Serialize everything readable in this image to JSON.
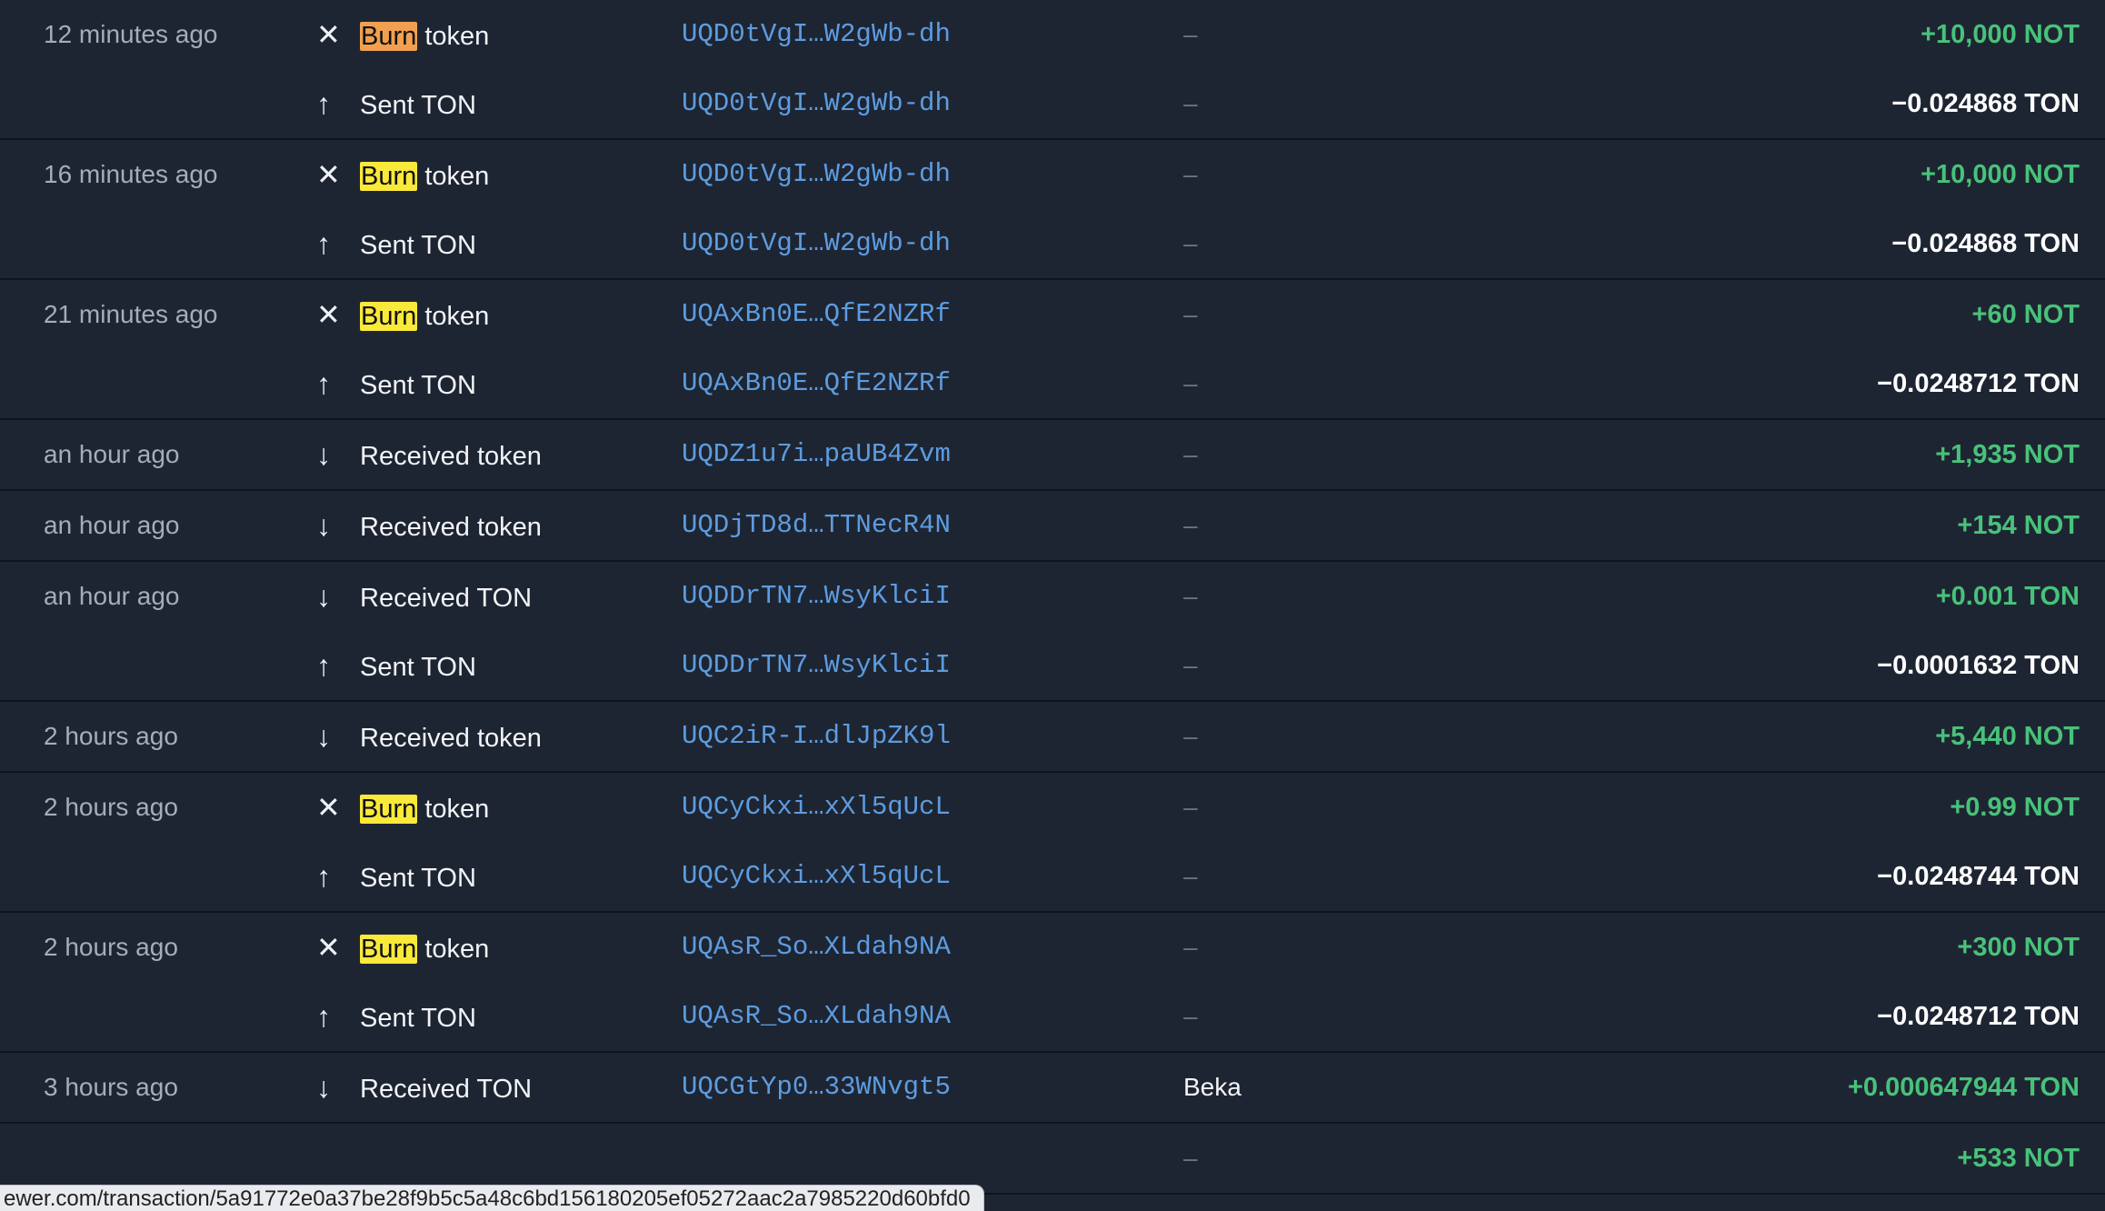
{
  "groups": [
    {
      "time": "12 minutes ago",
      "rows": [
        {
          "icon": "burn-icon",
          "glyph": "✕",
          "mark": "Burn",
          "mark_color": "#f0a050",
          "label": " token",
          "addr": "UQD0tVgI…W2gWb-dh",
          "memo": "–",
          "amount": "+10,000 NOT",
          "sign": "pos"
        },
        {
          "icon": "sent-arrow-icon",
          "glyph": "↑",
          "label": "Sent TON",
          "addr": "UQD0tVgI…W2gWb-dh",
          "memo": "–",
          "amount": "−0.024868 TON",
          "sign": "neg"
        }
      ]
    },
    {
      "time": "16 minutes ago",
      "rows": [
        {
          "icon": "burn-icon",
          "glyph": "✕",
          "mark": "Burn",
          "mark_color": "#f9e93a",
          "label": " token",
          "addr": "UQD0tVgI…W2gWb-dh",
          "memo": "–",
          "amount": "+10,000 NOT",
          "sign": "pos"
        },
        {
          "icon": "sent-arrow-icon",
          "glyph": "↑",
          "label": "Sent TON",
          "addr": "UQD0tVgI…W2gWb-dh",
          "memo": "–",
          "amount": "−0.024868 TON",
          "sign": "neg"
        }
      ]
    },
    {
      "time": "21 minutes ago",
      "rows": [
        {
          "icon": "burn-icon",
          "glyph": "✕",
          "mark": "Burn",
          "mark_color": "#f9e93a",
          "label": " token",
          "addr": "UQAxBn0E…QfE2NZRf",
          "memo": "–",
          "amount": "+60 NOT",
          "sign": "pos"
        },
        {
          "icon": "sent-arrow-icon",
          "glyph": "↑",
          "label": "Sent TON",
          "addr": "UQAxBn0E…QfE2NZRf",
          "memo": "–",
          "amount": "−0.0248712 TON",
          "sign": "neg"
        }
      ]
    },
    {
      "time": "an hour ago",
      "rows": [
        {
          "icon": "received-arrow-icon",
          "glyph": "↓",
          "label": "Received token",
          "addr": "UQDZ1u7i…paUB4Zvm",
          "memo": "–",
          "amount": "+1,935 NOT",
          "sign": "pos"
        }
      ]
    },
    {
      "time": "an hour ago",
      "rows": [
        {
          "icon": "received-arrow-icon",
          "glyph": "↓",
          "label": "Received token",
          "addr": "UQDjTD8d…TTNecR4N",
          "memo": "–",
          "amount": "+154 NOT",
          "sign": "pos"
        }
      ]
    },
    {
      "time": "an hour ago",
      "rows": [
        {
          "icon": "received-arrow-icon",
          "glyph": "↓",
          "label": "Received TON",
          "addr": "UQDDrTN7…WsyKlciI",
          "memo": "–",
          "amount": "+0.001 TON",
          "sign": "pos"
        },
        {
          "icon": "sent-arrow-icon",
          "glyph": "↑",
          "label": "Sent TON",
          "addr": "UQDDrTN7…WsyKlciI",
          "memo": "–",
          "amount": "−0.0001632 TON",
          "sign": "neg"
        }
      ]
    },
    {
      "time": "2 hours ago",
      "rows": [
        {
          "icon": "received-arrow-icon",
          "glyph": "↓",
          "label": "Received token",
          "addr": "UQC2iR-I…dlJpZK9l",
          "memo": "–",
          "amount": "+5,440 NOT",
          "sign": "pos"
        }
      ]
    },
    {
      "time": "2 hours ago",
      "rows": [
        {
          "icon": "burn-icon",
          "glyph": "✕",
          "mark": "Burn",
          "mark_color": "#f9e93a",
          "label": " token",
          "addr": "UQCyCkxi…xXl5qUcL",
          "memo": "–",
          "amount": "+0.99 NOT",
          "sign": "pos"
        },
        {
          "icon": "sent-arrow-icon",
          "glyph": "↑",
          "label": "Sent TON",
          "addr": "UQCyCkxi…xXl5qUcL",
          "memo": "–",
          "amount": "−0.0248744 TON",
          "sign": "neg"
        }
      ]
    },
    {
      "time": "2 hours ago",
      "rows": [
        {
          "icon": "burn-icon",
          "glyph": "✕",
          "mark": "Burn",
          "mark_color": "#f9e93a",
          "label": " token",
          "addr": "UQAsR_So…XLdah9NA",
          "memo": "–",
          "amount": "+300 NOT",
          "sign": "pos"
        },
        {
          "icon": "sent-arrow-icon",
          "glyph": "↑",
          "label": "Sent TON",
          "addr": "UQAsR_So…XLdah9NA",
          "memo": "–",
          "amount": "−0.0248712 TON",
          "sign": "neg"
        }
      ]
    },
    {
      "time": "3 hours ago",
      "rows": [
        {
          "icon": "received-arrow-icon",
          "glyph": "↓",
          "label": "Received TON",
          "addr": "UQCGtYp0…33WNvgt5",
          "memo": "Beka",
          "amount": "+0.000647944 TON",
          "sign": "pos"
        }
      ]
    },
    {
      "time": "",
      "rows": [
        {
          "icon": "",
          "glyph": "",
          "label": "",
          "addr": "",
          "memo": "–",
          "amount": "+533 NOT",
          "sign": "pos"
        }
      ]
    }
  ],
  "status_bar": {
    "url": "ewer.com/transaction/5a91772e0a37be28f9b5c5a48c6bd156180205ef05272aac2a7985220d60bfd0"
  },
  "colors": {
    "positive": "#48c27a",
    "negative": "#ffffff",
    "address": "#5d9ce0",
    "background": "#1e2532"
  }
}
